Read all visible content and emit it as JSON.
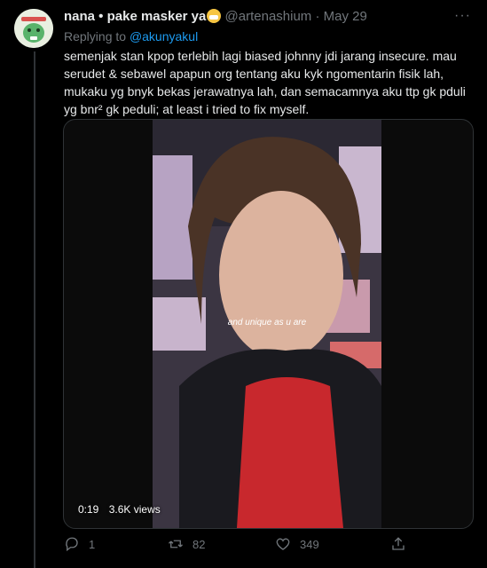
{
  "tweet": {
    "display_name": "nana • pake masker ya",
    "handle": "@artenashium",
    "separator": "·",
    "date": "May 29",
    "replying_prefix": "Replying to",
    "replying_to": "@akunyakul",
    "text": "semenjak stan kpop terlebih lagi biased johnny jdi jarang insecure. mau serudet & sebawel apapun org tentang aku kyk ngomentarin fisik lah, mukaku yg bnyk bekas jerawatnya lah, dan semacamnya aku ttp gk pduli yg bnr² gk peduli; at least i tried to fix myself.",
    "emoji_icon": "face-with-medical-mask-icon",
    "more_label": "···"
  },
  "media": {
    "caption": "and unique as u are",
    "duration": "0:19",
    "views": "3.6K views"
  },
  "actions": {
    "reply_count": "1",
    "retweet_count": "82",
    "like_count": "349"
  },
  "colors": {
    "background": "#000000",
    "accent": "#1d9bf0",
    "muted": "#71767b"
  }
}
